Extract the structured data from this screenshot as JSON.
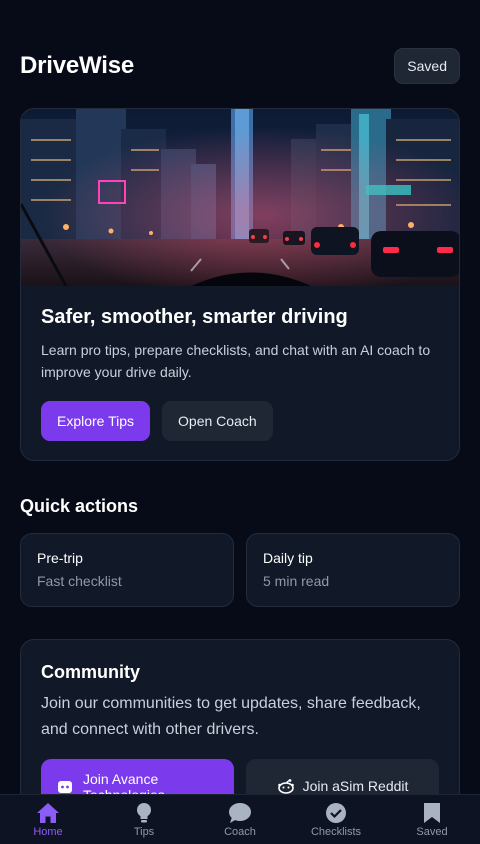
{
  "header": {
    "app_name": "DriveWise",
    "saved_label": "Saved"
  },
  "hero": {
    "image_icon": "city-night-drive-photo",
    "title": "Safer, smoother, smarter driving",
    "description": "Learn pro tips, prepare checklists, and chat with an AI coach to improve your drive daily.",
    "primary_label": "Explore Tips",
    "secondary_label": "Open Coach"
  },
  "quick_actions": {
    "title": "Quick actions",
    "cards": [
      {
        "title": "Pre-trip",
        "subtitle": "Fast checklist"
      },
      {
        "title": "Daily tip",
        "subtitle": "5 min read"
      }
    ]
  },
  "community": {
    "title": "Community",
    "description": "Join our communities to get updates, share feedback, and connect with other drivers.",
    "discord_label": "Join Avance Technologies",
    "reddit_label": "Join aSim Reddit"
  },
  "tabs": [
    {
      "label": "Home",
      "icon": "home-icon",
      "active": true
    },
    {
      "label": "Tips",
      "icon": "lightbulb-icon",
      "active": false
    },
    {
      "label": "Coach",
      "icon": "chat-icon",
      "active": false
    },
    {
      "label": "Checklists",
      "icon": "check-badge-icon",
      "active": false
    },
    {
      "label": "Saved",
      "icon": "bookmark-icon",
      "active": false
    }
  ],
  "colors": {
    "background": "#070b17",
    "card": "#111827",
    "accent": "#7c3aed",
    "active_tab": "#8b5cf6"
  }
}
